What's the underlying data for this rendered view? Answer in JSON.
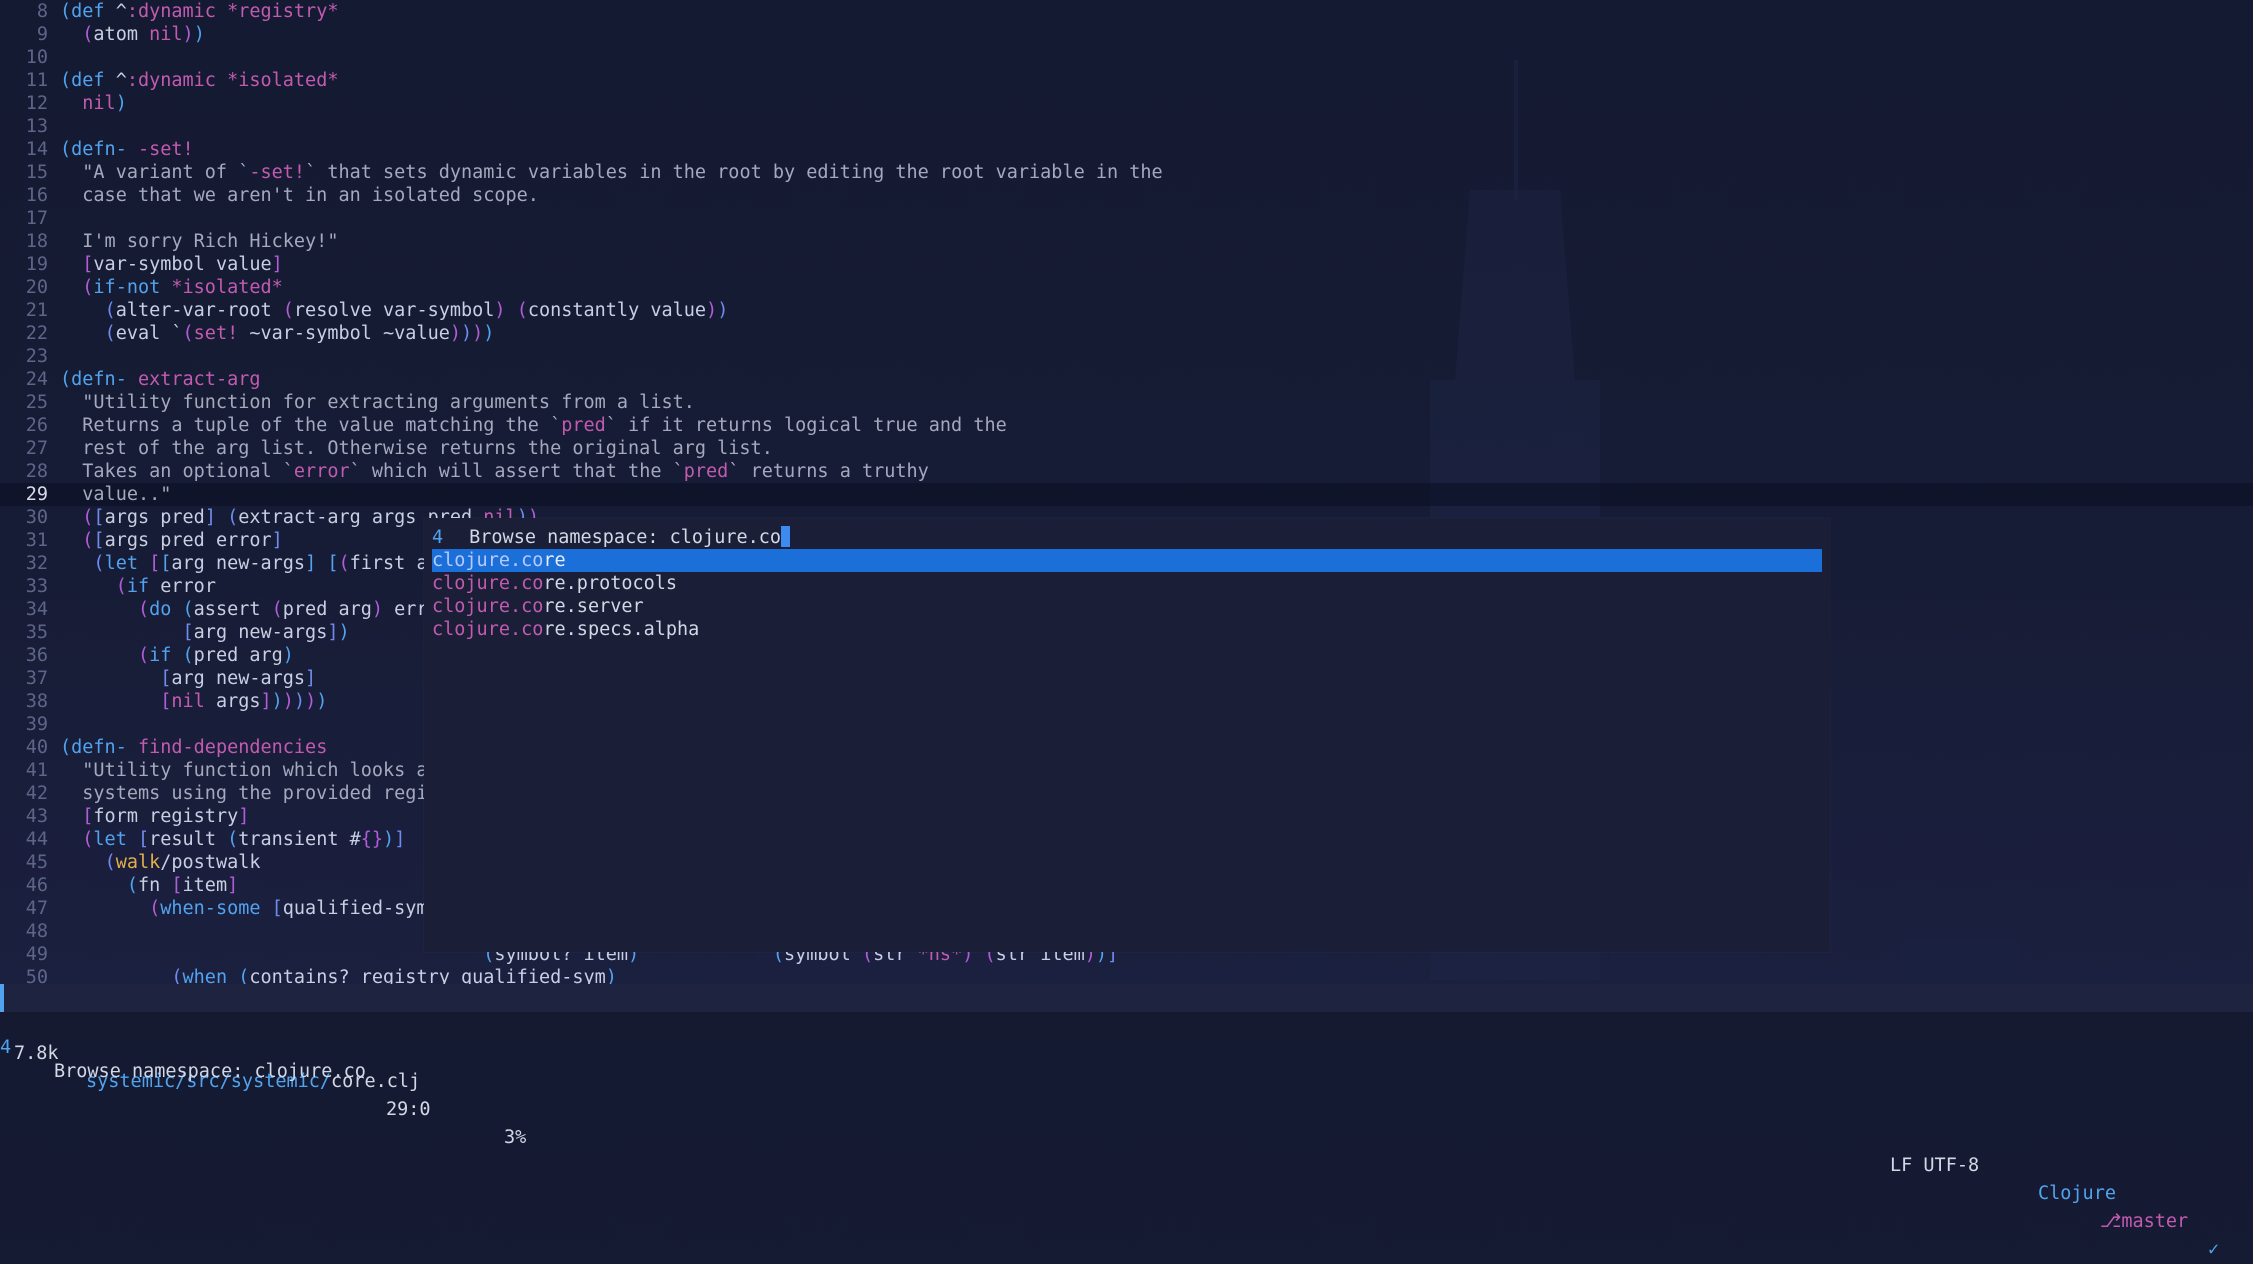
{
  "editor": {
    "current_line": "29",
    "lines": [
      {
        "n": "8",
        "code": "<span class='p1'>(</span><span class='k'>def</span> ^<span class='m'>:dynamic</span> <span class='m'>*registry*</span>"
      },
      {
        "n": "9",
        "code": "  <span class='p2'>(</span>atom <span class='m'>nil</span><span class='p2'>)</span><span class='p1'>)</span>"
      },
      {
        "n": "10",
        "code": ""
      },
      {
        "n": "11",
        "code": "<span class='p1'>(</span><span class='k'>def</span> ^<span class='m'>:dynamic</span> <span class='m'>*isolated*</span>"
      },
      {
        "n": "12",
        "code": "  <span class='m'>nil</span><span class='p1'>)</span>"
      },
      {
        "n": "13",
        "code": ""
      },
      {
        "n": "14",
        "code": "<span class='p1'>(</span><span class='k'>defn-</span> <span class='m'>-set!</span>"
      },
      {
        "n": "15",
        "code": "  <span class='s'>\"A variant of `</span><span class='m'>-set!</span><span class='s'>` that sets dynamic variables in the root by editing the root variable in the</span>"
      },
      {
        "n": "16",
        "code": "  <span class='s'>case that we aren't in an isolated scope.</span>"
      },
      {
        "n": "17",
        "code": ""
      },
      {
        "n": "18",
        "code": "  <span class='s'>I'm sorry Rich Hickey!\"</span>"
      },
      {
        "n": "19",
        "code": "  <span class='p2'>[</span>var-symbol value<span class='p2'>]</span>"
      },
      {
        "n": "20",
        "code": "  <span class='p2'>(</span><span class='k'>if-not</span> <span class='m'>*isolated*</span>"
      },
      {
        "n": "21",
        "code": "    <span class='p3'>(</span>alter-var-root <span class='p2'>(</span>resolve var-symbol<span class='p2'>)</span> <span class='p2'>(</span>constantly value<span class='p2'>)</span><span class='p3'>)</span>"
      },
      {
        "n": "22",
        "code": "    <span class='p3'>(</span>eval `<span class='p2'>(</span><span class='m'>set!</span> ~var-symbol ~value<span class='p2'>)</span><span class='p3'>)</span><span class='p2'>)</span><span class='p1'>)</span>"
      },
      {
        "n": "23",
        "code": ""
      },
      {
        "n": "24",
        "code": "<span class='p1'>(</span><span class='k'>defn-</span> <span class='m'>extract-arg</span>"
      },
      {
        "n": "25",
        "code": "  <span class='s'>\"Utility function for extracting arguments from a list.</span>"
      },
      {
        "n": "26",
        "code": "  <span class='s'>Returns a tuple of the value matching the `</span><span class='m'>pred</span><span class='s'>` if it returns logical true and the</span>"
      },
      {
        "n": "27",
        "code": "  <span class='s'>rest of the arg list. Otherwise returns the original arg list.</span>"
      },
      {
        "n": "28",
        "code": "  <span class='s'>Takes an optional `</span><span class='m'>error</span><span class='s'>` which will assert that the `</span><span class='m'>pred</span><span class='s'>` returns a truthy</span>"
      },
      {
        "n": "29",
        "code": "  <span class='s'>value..\"</span>"
      },
      {
        "n": "30",
        "code": "  <span class='p2'>(</span><span class='p3'>[</span>args pred<span class='p3'>]</span> <span class='p3'>(</span>extract-arg args pred <span class='m'>nil</span><span class='p3'>)</span><span class='p2'>)</span>"
      },
      {
        "n": "31",
        "code": "  <span class='p2'>(</span><span class='p3'>[</span>args pred error<span class='p3'>]</span>"
      },
      {
        "n": "32",
        "code": "   <span class='p3'>(</span><span class='k'>let</span> <span class='p2'>[</span><span class='p1'>[</span>arg new-args<span class='p1'>]</span> <span class='p1'>[</span><span class='p2'>(</span>first a"
      },
      {
        "n": "33",
        "code": "     <span class='p2'>(</span><span class='k'>if</span> error"
      },
      {
        "n": "34",
        "code": "       <span class='p2'>(</span><span class='k'>do</span> <span class='p1'>(</span>assert <span class='p2'>(</span>pred arg<span class='p2'>)</span> err"
      },
      {
        "n": "35",
        "code": "           <span class='p3'>[</span>arg new-args<span class='p3'>]</span><span class='p1'>)</span>"
      },
      {
        "n": "36",
        "code": "       <span class='p2'>(</span><span class='k'>if</span> <span class='p1'>(</span>pred arg<span class='p1'>)</span>"
      },
      {
        "n": "37",
        "code": "         <span class='p3'>[</span>arg new-args<span class='p3'>]</span>"
      },
      {
        "n": "38",
        "code": "         <span class='p2'>[</span><span class='m'>nil</span> args<span class='p2'>]</span><span class='p1'>)</span><span class='p2'>)</span><span class='p3'>)</span><span class='p2'>)</span><span class='p1'>)</span>"
      },
      {
        "n": "39",
        "code": ""
      },
      {
        "n": "40",
        "code": "<span class='p1'>(</span><span class='k'>defn-</span> <span class='m'>find-dependencies</span>"
      },
      {
        "n": "41",
        "code": "  <span class='s'>\"Utility function which looks a</span>"
      },
      {
        "n": "42",
        "code": "  <span class='s'>systems using the provided regi</span>"
      },
      {
        "n": "43",
        "code": "  <span class='p2'>[</span>form registry<span class='p2'>]</span>"
      },
      {
        "n": "44",
        "code": "  <span class='p2'>(</span><span class='k'>let</span> <span class='p3'>[</span>result <span class='p1'>(</span>transient #<span class='p2'>{}</span><span class='p1'>)</span><span class='p3'>]</span>"
      },
      {
        "n": "45",
        "code": "    <span class='p3'>(</span><span class='y'>walk</span>/postwalk"
      },
      {
        "n": "46",
        "code": "      <span class='p1'>(</span>fn <span class='p2'>[</span>item<span class='p2'>]</span>"
      },
      {
        "n": "47",
        "code": "        <span class='p2'>(</span><span class='k'>when-some</span> <span class='p3'>[</span>qualified-sym"
      },
      {
        "n": "48",
        "code": ""
      },
      {
        "n": "49",
        "code": "                                      <span class='p1'>(</span>symbol? item<span class='p1'>)</span>            <span class='p1'>(</span>symbol <span class='p2'>(</span>str <span class='m'>*ns*</span><span class='p2'>)</span> <span class='p2'>(</span>str item<span class='p2'>)</span><span class='p1'>)</span><span class='p3'>]</span>"
      },
      {
        "n": "50",
        "code": "          <span class='p3'>(</span><span class='k'>when</span> <span class='p1'>(</span>contains? registry qualified-sym<span class='p1'>)</span>"
      }
    ]
  },
  "popup": {
    "count": "4",
    "prompt_label": "Browse namespace:",
    "input_value": "clojure.co",
    "candidates": [
      {
        "match": "clojure.co",
        "rest": "re",
        "selected": true
      },
      {
        "match": "clojure.co",
        "rest": "re.protocols",
        "selected": false
      },
      {
        "match": "clojure.co",
        "rest": "re.server",
        "selected": false
      },
      {
        "match": "clojure.co",
        "rest": "re.specs.alpha",
        "selected": false
      }
    ]
  },
  "modeline": {
    "size": "7.8k",
    "path_dir": "systemic/src/systemic/",
    "path_file": "core.clj",
    "position": "29:0",
    "percent": "3%",
    "encoding": "LF UTF-8",
    "major_mode": "Clojure",
    "branch": "master",
    "branch_icon": "git-branch-icon",
    "status_icon": "check-icon"
  },
  "minibuffer": {
    "count": "4",
    "text": "Browse namespace: clojure.co"
  }
}
